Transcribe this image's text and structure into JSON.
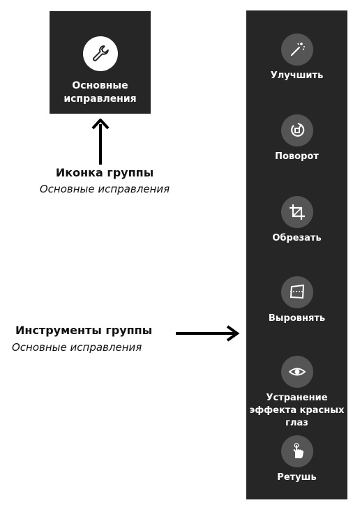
{
  "group_tile": {
    "label": "Основные\nисправления",
    "icon": "wrench-icon"
  },
  "caption": {
    "title": "Иконка группы",
    "subtitle": "Основные исправления"
  },
  "tools_caption": {
    "title": "Инструменты группы",
    "subtitle": "Основные исправления"
  },
  "tools": [
    {
      "label": "Улучшить",
      "icon": "magic-wand-icon"
    },
    {
      "label": "Поворот",
      "icon": "rotate-icon"
    },
    {
      "label": "Обрезать",
      "icon": "crop-icon"
    },
    {
      "label": "Выровнять",
      "icon": "straighten-icon"
    },
    {
      "label": "Устранение\nэффекта красных\nглаз",
      "icon": "eye-icon"
    },
    {
      "label": "Ретушь",
      "icon": "retouch-hand-icon"
    }
  ],
  "colors": {
    "panel": "#262626",
    "icon_circle": "#555555",
    "text_on_dark": "#ffffff"
  }
}
